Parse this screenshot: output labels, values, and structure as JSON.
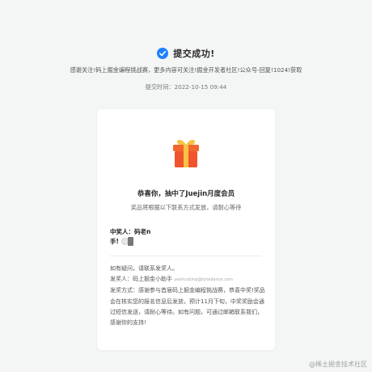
{
  "success": {
    "title": "提交成功!",
    "check_color": "#1e80ff"
  },
  "thanks_line": "感谢关注!码上掘金编程挑战赛，更多内容可关注!掘金开发者社区!公众号-回复!1024!获取",
  "submit_time": "提交时间：2022-10-15 09:44",
  "card": {
    "win_title": "恭喜你，抽中了Juejin月度会员",
    "win_subtitle": "奖品将根据以下联系方式发放，请耐心等待",
    "winner_label": "中奖人：",
    "winner_name": "码老n",
    "winner_handle": "手!",
    "notes_line1": "如有疑问，请联系发奖人。",
    "notes_line2_prefix": "发奖人：码上掘金小助手",
    "notes_email": "yeahcoding@bytedance.com",
    "notes_line3": "发奖方式：感谢参与首届码上掘金编程挑战赛，恭喜中奖!奖品会在核实您的报名信息后发放，预计11月下旬，中奖奖励会通过短信发送，请耐心等待。如有问题，可通过邮箱联系我们，感谢你的支持!"
  },
  "icons": {
    "check": "check-circle-icon",
    "gift": "gift-icon",
    "phone": "phone-icon"
  },
  "watermark": "@稀土掘金技术社区"
}
